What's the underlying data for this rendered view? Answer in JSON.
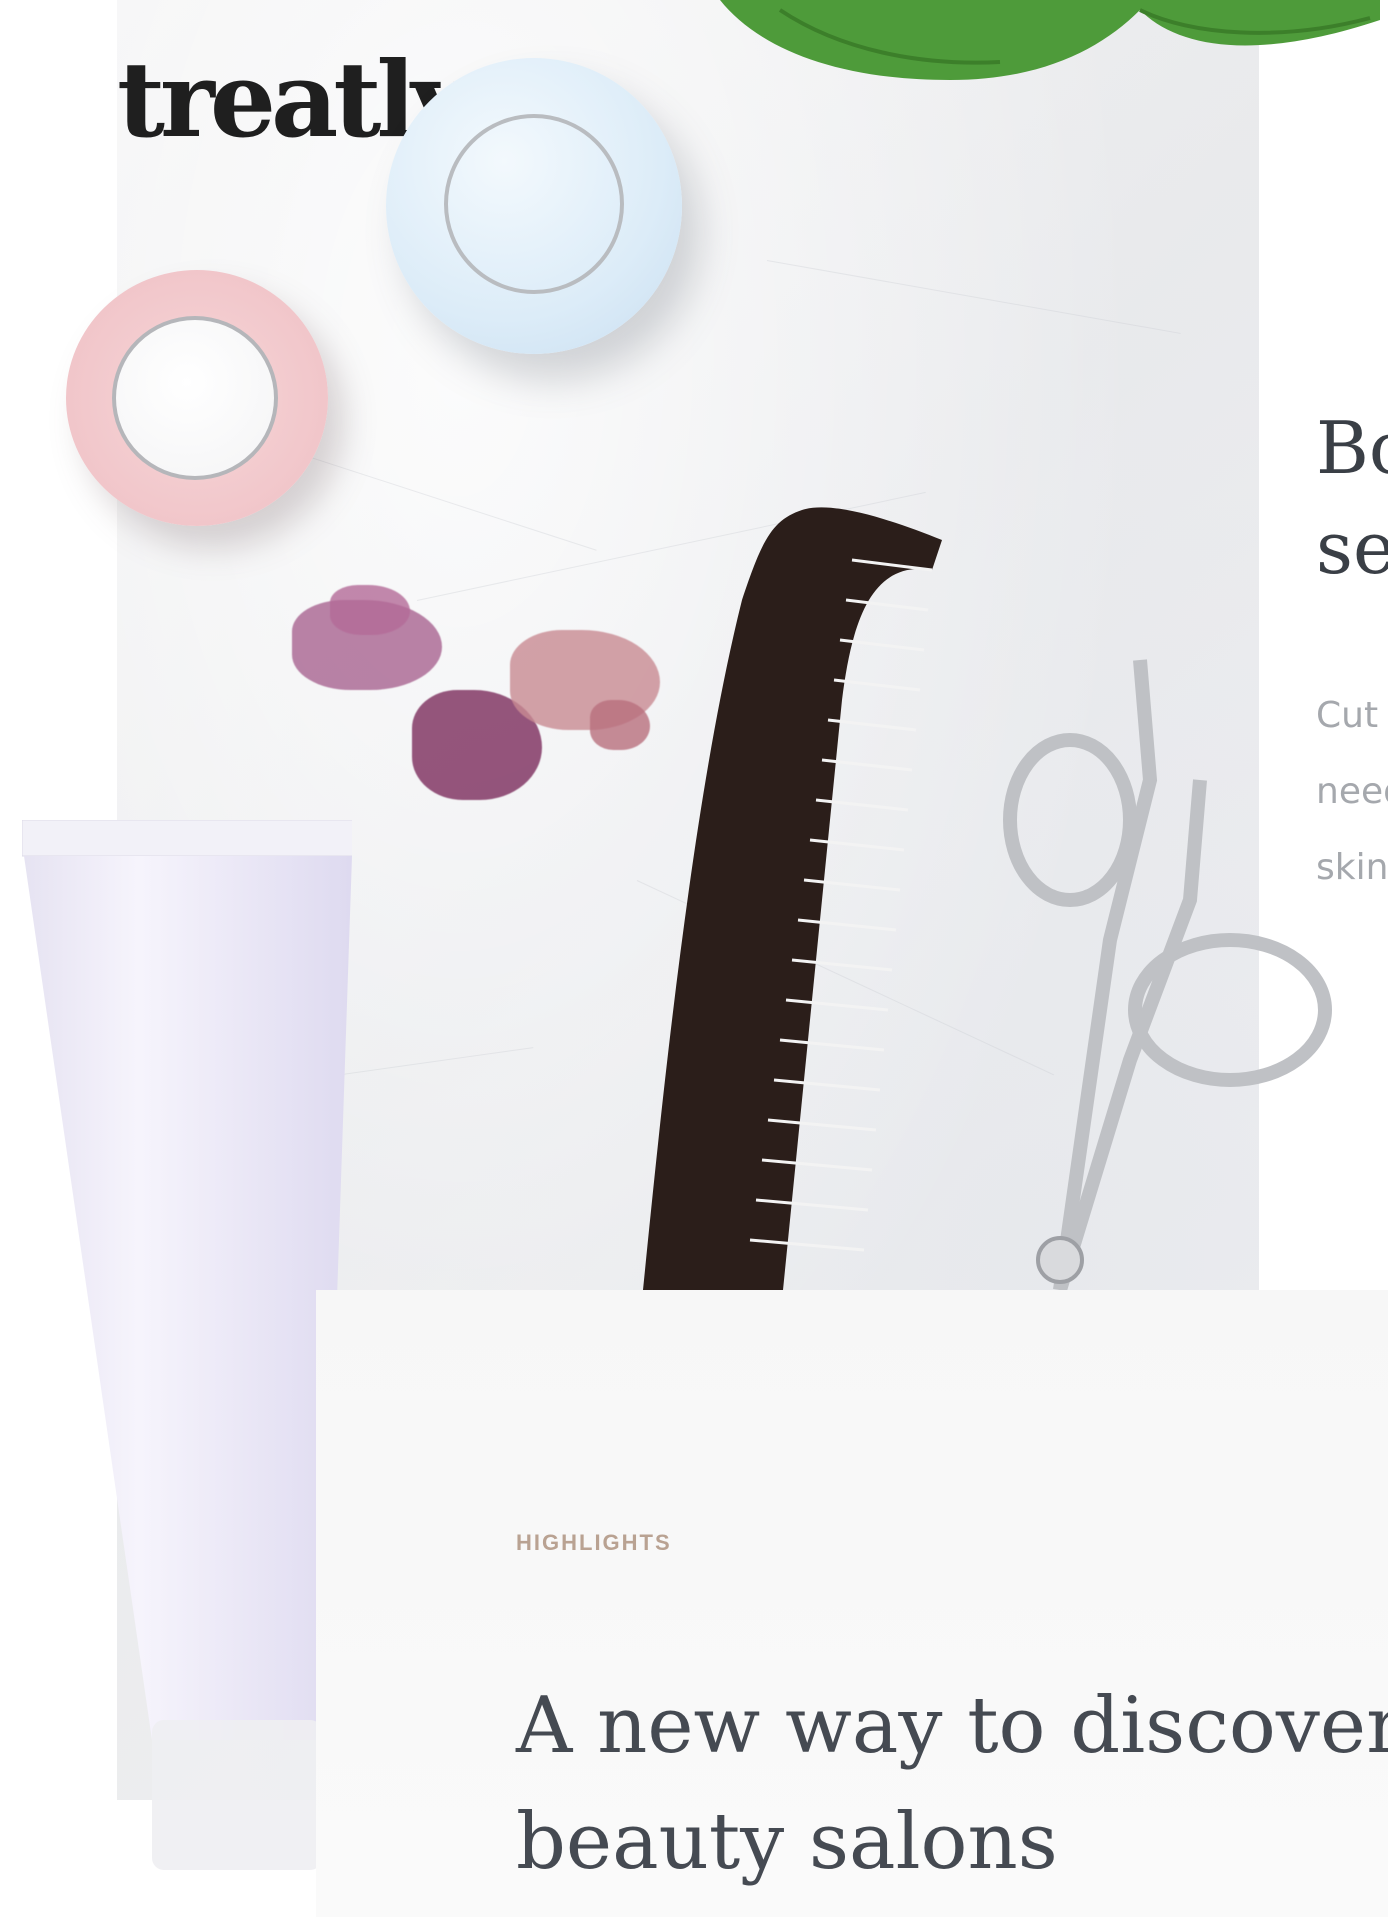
{
  "brand": {
    "logo_text": "treatly"
  },
  "side_section": {
    "title_lines": [
      "Bo",
      "se"
    ],
    "text_lines": [
      "Cut",
      "need",
      "skin"
    ]
  },
  "highlight_card": {
    "eyebrow": "HIGHLIGHTS",
    "title_lines": [
      "A new way to discover",
      "beauty salons"
    ]
  },
  "colors": {
    "eyebrow": "#b9a292",
    "heading": "#454a52",
    "body_text": "#a5a8ad",
    "logo": "#1f1f1f"
  },
  "icons": [
    "leaf-image",
    "cream-jar-image",
    "comb-image",
    "scissors-image",
    "tube-image"
  ]
}
